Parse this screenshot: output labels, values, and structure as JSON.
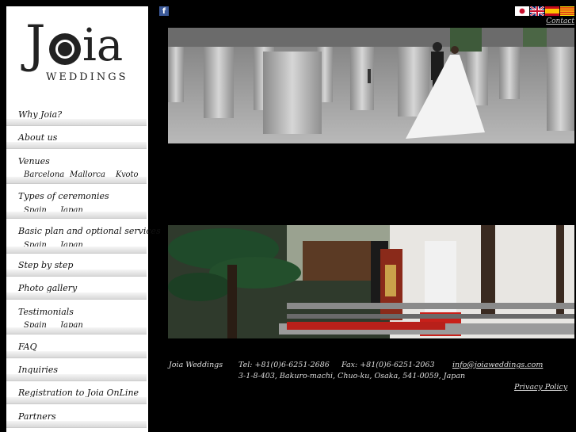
{
  "logo": {
    "top": "Joia",
    "sub": "WEDDINGS"
  },
  "nav": {
    "why": "Why Joia?",
    "about": "About us",
    "venues": "Venues",
    "venues_sub": [
      "Barcelona",
      "Mallorca",
      "Kyoto"
    ],
    "types": "Types of ceremonies",
    "types_sub": [
      "Spain",
      "Japan"
    ],
    "basic": "Basic plan and optional services",
    "basic_sub": [
      "Spain",
      "Japan"
    ],
    "step": "Step by step",
    "gallery": "Photo gallery",
    "testimonials": "Testimonials",
    "testimonials_sub": [
      "Spain",
      "Japan"
    ],
    "faq": "FAQ",
    "inquiries": "Inquiries",
    "registration": "Registration to Joia OnLine",
    "partners": "Partners"
  },
  "header": {
    "facebook": "f",
    "contact": "Contact",
    "flags": [
      "japan-flag",
      "uk-flag",
      "spain-flag",
      "catalonia-flag"
    ]
  },
  "footer": {
    "company": "Joia Weddings",
    "tel": "Tel: +81(0)6-6251-2686",
    "fax": "Fax: +81(0)6-6251-2063",
    "email": "info@joiaweddings.com",
    "address": "3-1-8-403, Bakuro-machi, Chuo-ku, Osaka, 541-0059, Japan",
    "privacy": "Privacy Policy"
  },
  "colors": {
    "background": "#000000",
    "sidebar": "#ffffff",
    "footer_text": "#dddddd"
  }
}
